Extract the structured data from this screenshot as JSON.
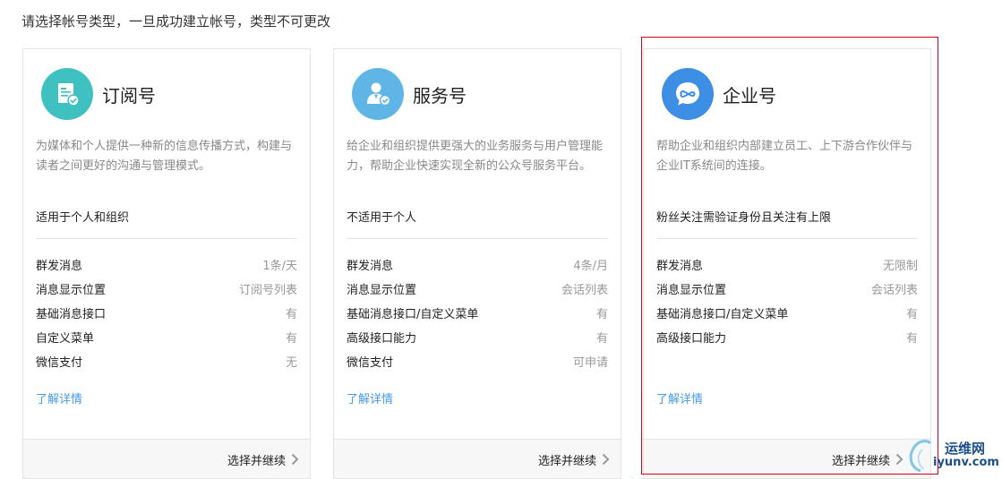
{
  "heading": "请选择帐号类型，一旦成功建立帐号，类型不可更改",
  "colors": {
    "subscription_icon": "#3fc1c2",
    "service_icon": "#5fb6e6",
    "enterprise_icon": "#3d8fe6",
    "link": "#459ae9",
    "selected_border": "#d9001b"
  },
  "cards": [
    {
      "title": "订阅号",
      "icon": "document-check-icon",
      "description": "为媒体和个人提供一种新的信息传播方式，构建与读者之间更好的沟通与管理模式。",
      "suitability": "适用于个人和组织",
      "features": [
        {
          "name": "群发消息",
          "value": "1条/天"
        },
        {
          "name": "消息显示位置",
          "value": "订阅号列表"
        },
        {
          "name": "基础消息接口",
          "value": "有"
        },
        {
          "name": "自定义菜单",
          "value": "有"
        },
        {
          "name": "微信支付",
          "value": "无"
        }
      ],
      "learn_more": "了解详情",
      "continue_label": "选择并继续"
    },
    {
      "title": "服务号",
      "icon": "person-check-icon",
      "description": "给企业和组织提供更强大的业务服务与用户管理能力，帮助企业快速实现全新的公众号服务平台。",
      "suitability": "不适用于个人",
      "features": [
        {
          "name": "群发消息",
          "value": "4条/月"
        },
        {
          "name": "消息显示位置",
          "value": "会话列表"
        },
        {
          "name": "基础消息接口/自定义菜单",
          "value": "有"
        },
        {
          "name": "高级接口能力",
          "value": "有"
        },
        {
          "name": "微信支付",
          "value": "可申请"
        }
      ],
      "learn_more": "了解详情",
      "continue_label": "选择并继续"
    },
    {
      "title": "企业号",
      "icon": "chat-bubble-infinity-icon",
      "description": "帮助企业和组织内部建立员工、上下游合作伙伴与企业IT系统间的连接。",
      "suitability": "粉丝关注需验证身份且关注有上限",
      "features": [
        {
          "name": "群发消息",
          "value": "无限制"
        },
        {
          "name": "消息显示位置",
          "value": "会话列表"
        },
        {
          "name": "基础消息接口/自定义菜单",
          "value": "有"
        },
        {
          "name": "高级接口能力",
          "value": "有"
        }
      ],
      "learn_more": "了解详情",
      "continue_label": "选择并继续"
    }
  ],
  "watermark": {
    "line1": "运维网",
    "line2": "iyunv.com"
  }
}
